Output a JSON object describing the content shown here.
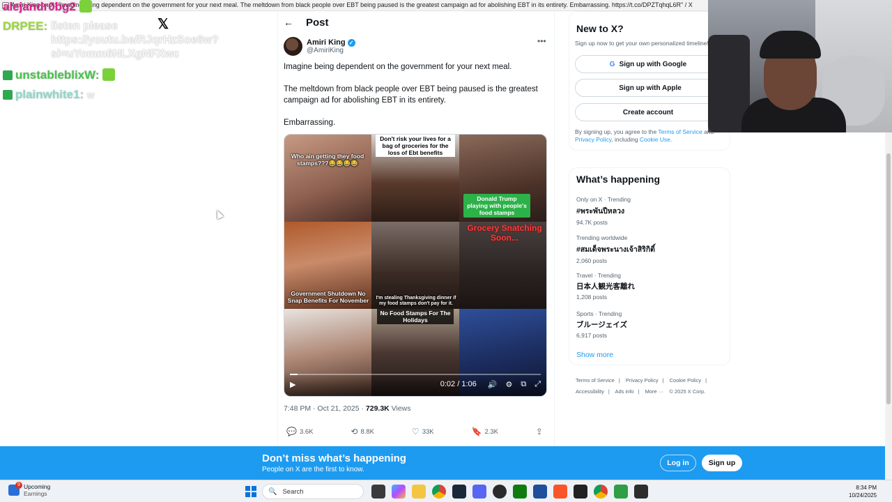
{
  "window": {
    "title": "Amiri King on X: \"Imagine being dependent on the government for your next meal. The meltdown from black people over EBT being paused is the greatest campaign ad for abolishing EBT in its entirety. Embarrassing. https://t.co/DPZTqhqL6R\" / X"
  },
  "chat": [
    {
      "user": "alejandr0bg2",
      "user_color": "#e0208c",
      "message": ""
    },
    {
      "user": "DRPEE:",
      "user_color": "#9ad63a",
      "message": "listen please https://youtu.be/RJqrHzSoe6w?si=uYomm6NLXgNFXwc"
    },
    {
      "user": "unstableblixW:",
      "user_color": "#47c24a",
      "message": "W"
    },
    {
      "user": "plainwhite1:",
      "user_color": "#8fd6c8",
      "message": "W"
    }
  ],
  "post_header": {
    "back": "←",
    "title": "Post"
  },
  "author": {
    "name": "Amiri King",
    "handle": "@AmiriKing"
  },
  "tweet": {
    "p1": "Imagine being dependent on the government for your next meal.",
    "p2": "The meltdown from black people over EBT being paused is the greatest campaign ad for abolishing EBT in its entirety.",
    "p3": "Embarrassing."
  },
  "video": {
    "captions": {
      "c1": "Who ain getting they food stamps???😂😂😂😂",
      "c2": "Don't risk your lives for a bag of groceries for the loss of Ebt benefits",
      "c3": "Donald Trump playing with people's food stamps",
      "c4": "Government Shutdown No Snap Benefits For November",
      "c5": "I'm stealing Thanksgiving dinner if my food stamps don't pay for it.",
      "c6": "Grocery Snatching Soon...",
      "c7": "No Food Stamps For The Holidays"
    },
    "time": "0:02 / 1:06",
    "progress": 0.03
  },
  "meta": {
    "timestamp": "7:48 PM · Oct 21, 2025 · ",
    "views_count": "729.3K",
    "views_label": " Views"
  },
  "actions": {
    "replies": "3.6K",
    "reposts": "8.8K",
    "likes": "33K",
    "bookmarks": "2.3K"
  },
  "new_to_x": {
    "title": "New to X?",
    "subtitle": "Sign up now to get your own personalized timeline!",
    "google": "Sign up with Google",
    "apple": "Sign up with Apple",
    "create": "Create account",
    "terms_pre": "By signing up, you agree to the ",
    "terms_link": "Terms of Service",
    "terms_mid": " and ",
    "privacy_link": "Privacy Policy",
    "terms_post": ", including ",
    "cookie_link": "Cookie Use",
    "terms_end": "."
  },
  "happening": {
    "title": "What’s happening",
    "trends": [
      {
        "context": "Only on X · Trending",
        "name": "#พระพันปีหลวง",
        "count": "94.7K posts"
      },
      {
        "context": "Trending worldwide",
        "name": "#สมเด็จพระนางเจ้าสิริกิติ์",
        "count": "2,060 posts"
      },
      {
        "context": "Travel · Trending",
        "name": "日本人観光客離れ",
        "count": "1,208 posts"
      },
      {
        "context": "Sports · Trending",
        "name": "ブルージェイズ",
        "count": "6,917 posts"
      }
    ],
    "show_more": "Show more"
  },
  "footer": {
    "terms": "Terms of Service",
    "privacy": "Privacy Policy",
    "cookie": "Cookie Policy",
    "accessibility": "Accessibility",
    "ads": "Ads info",
    "more": "More ···",
    "copyright": "© 2025 X Corp."
  },
  "banner": {
    "title": "Don’t miss what’s happening",
    "subtitle": "People on X are the first to know.",
    "login": "Log in",
    "signup": "Sign up"
  },
  "taskbar": {
    "weather_title": "Upcoming",
    "weather_sub": "Earnings",
    "weather_badge": "9",
    "search": "Search",
    "time": "8:34 PM",
    "date": "10/24/2025"
  }
}
